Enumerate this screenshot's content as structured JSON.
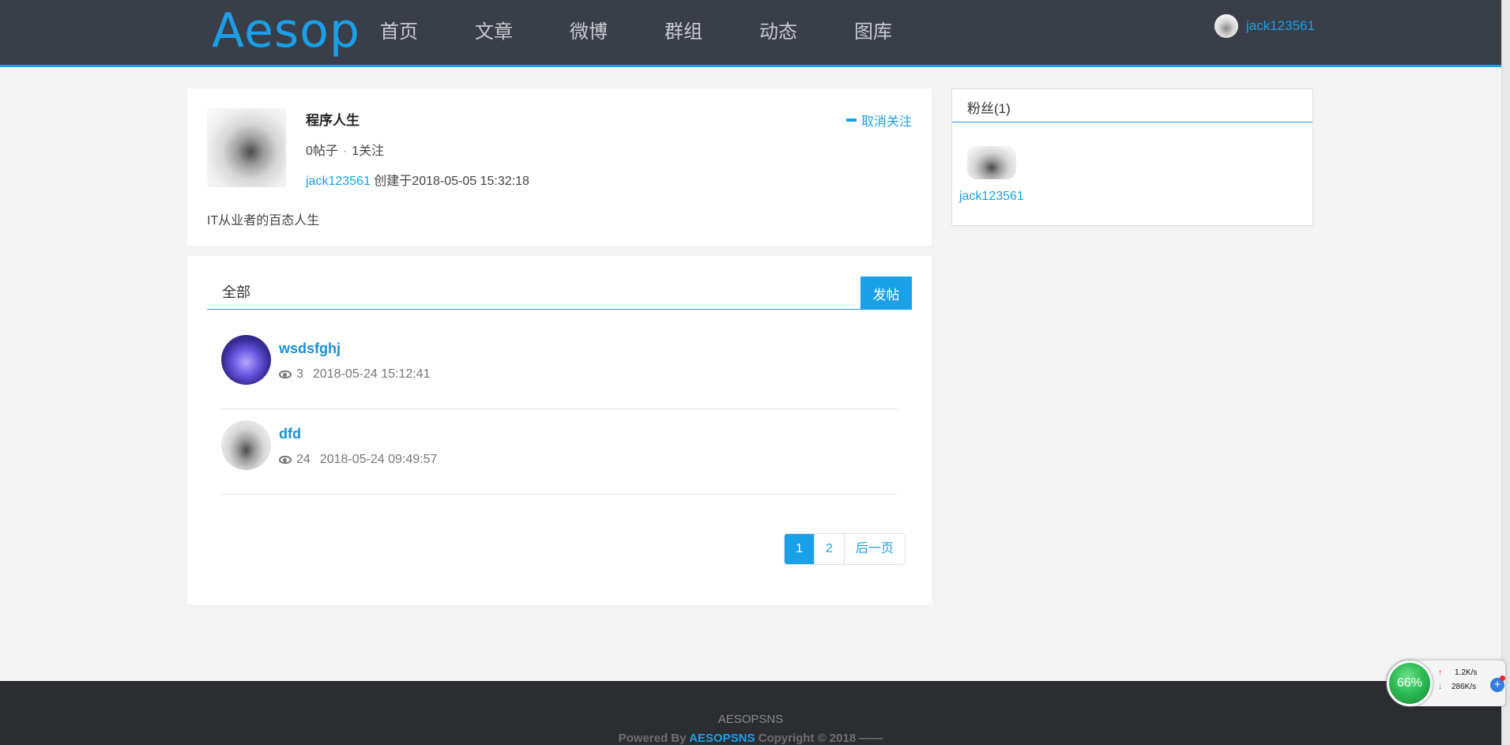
{
  "header": {
    "logo": "Aesop",
    "nav": [
      "首页",
      "文章",
      "微博",
      "群组",
      "动态",
      "图库"
    ],
    "username": "jack123561"
  },
  "group": {
    "name": "程序人生",
    "posts_label": "0帖子",
    "separator": "·",
    "follows_label": "1关注",
    "creator": "jack123561",
    "created_text": " 创建于2018-05-05 15:32:18",
    "description": "IT从业者的百态人生",
    "unfollow_label": "取消关注"
  },
  "posts_section": {
    "tab_label": "全部",
    "post_button": "发帖",
    "posts": [
      {
        "title": "wsdsfghj",
        "views": "3",
        "date": "2018-05-24 15:12:41"
      },
      {
        "title": "dfd",
        "views": "24",
        "date": "2018-05-24 09:49:57"
      }
    ],
    "pagination": {
      "pages": [
        "1",
        "2"
      ],
      "current": "1",
      "next_label": "后一页"
    }
  },
  "fans": {
    "title": "粉丝(1)",
    "members": [
      {
        "name": "jack123561"
      }
    ]
  },
  "footer": {
    "site": "AESOPSNS",
    "powered_prefix": "Powered By ",
    "brand": "AESOPSNS",
    "copyright": " Copyright © 2018 ——"
  },
  "widget": {
    "percent": "66%",
    "upload": "1.2K/s",
    "download": "286K/s"
  },
  "colors": {
    "accent": "#1aa0e8",
    "header_bg": "#3a3e48",
    "footer_bg": "#2b2d31"
  }
}
